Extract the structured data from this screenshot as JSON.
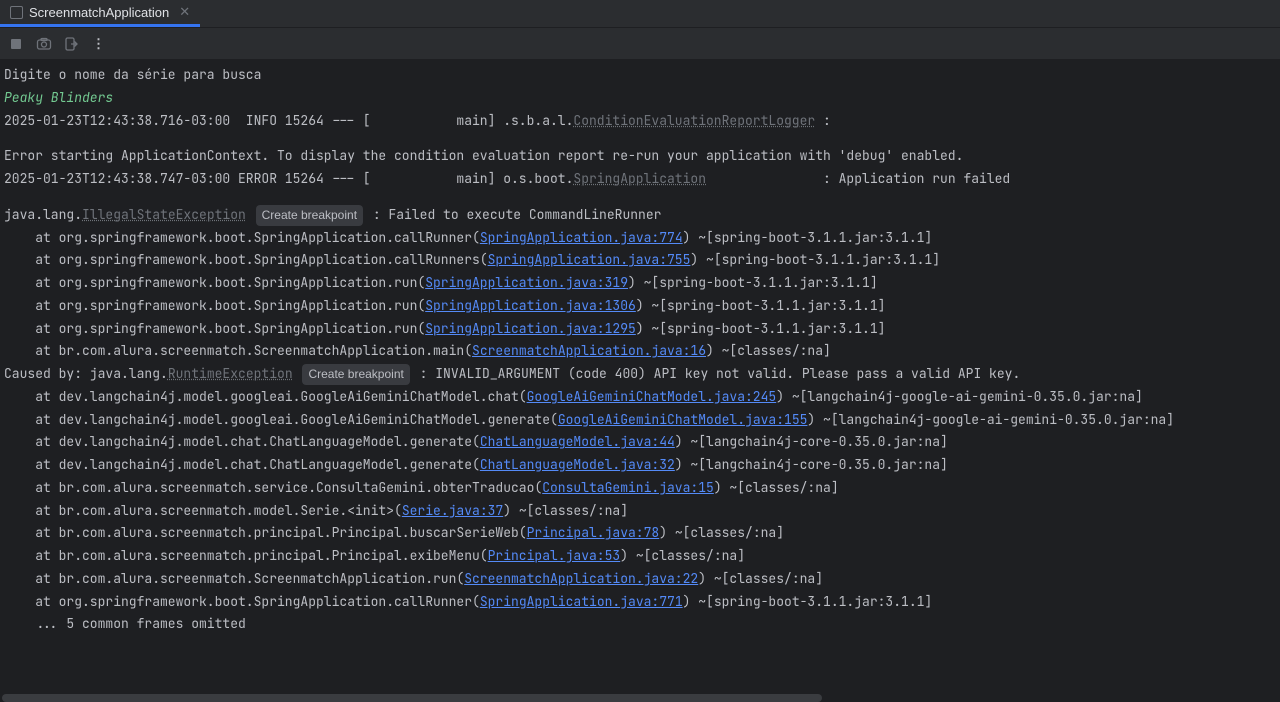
{
  "tab": {
    "title": "ScreenmatchApplication"
  },
  "console": {
    "prompt_line": "Digite o nome da série para busca",
    "user_input": "Peaky Blinders",
    "log_line1_prefix": "2025-01-23T12:43:38.716-03:00  INFO 15264 --- [           main] .s.b.a.l.",
    "log_line1_class": "ConditionEvaluationReportLogger",
    "log_line1_suffix": " :",
    "error_line": "Error starting ApplicationContext. To display the condition evaluation report re-run your application with 'debug' enabled.",
    "log_line2_prefix": "2025-01-23T12:43:38.747-03:00 ERROR 15264 --- [           main] o.s.boot.",
    "log_line2_class": "SpringApplication",
    "log_line2_suffix": "               : Application run failed",
    "exc_line_prefix": "java.lang.",
    "exc_class": "IllegalStateException",
    "breakpoint_label": "Create breakpoint",
    "exc_line_suffix": ": Failed to execute CommandLineRunner",
    "stack": [
      {
        "pre": "at org.springframework.boot.SpringApplication.callRunner(",
        "link": "SpringApplication.java:774",
        "post": ") ~[spring-boot-3.1.1.jar:3.1.1]"
      },
      {
        "pre": "at org.springframework.boot.SpringApplication.callRunners(",
        "link": "SpringApplication.java:755",
        "post": ") ~[spring-boot-3.1.1.jar:3.1.1]"
      },
      {
        "pre": "at org.springframework.boot.SpringApplication.run(",
        "link": "SpringApplication.java:319",
        "post": ") ~[spring-boot-3.1.1.jar:3.1.1]"
      },
      {
        "pre": "at org.springframework.boot.SpringApplication.run(",
        "link": "SpringApplication.java:1306",
        "post": ") ~[spring-boot-3.1.1.jar:3.1.1]"
      },
      {
        "pre": "at org.springframework.boot.SpringApplication.run(",
        "link": "SpringApplication.java:1295",
        "post": ") ~[spring-boot-3.1.1.jar:3.1.1]"
      },
      {
        "pre": "at br.com.alura.screenmatch.ScreenmatchApplication.main(",
        "link": "ScreenmatchApplication.java:16",
        "post": ") ~[classes/:na]"
      }
    ],
    "caused_prefix": "Caused by: java.lang.",
    "caused_class": "RuntimeException",
    "caused_suffix": ": INVALID_ARGUMENT (code 400) API key not valid. Please pass a valid API key.",
    "stack2": [
      {
        "pre": "at dev.langchain4j.model.googleai.GoogleAiGeminiChatModel.chat(",
        "link": "GoogleAiGeminiChatModel.java:245",
        "post": ") ~[langchain4j-google-ai-gemini-0.35.0.jar:na]"
      },
      {
        "pre": "at dev.langchain4j.model.googleai.GoogleAiGeminiChatModel.generate(",
        "link": "GoogleAiGeminiChatModel.java:155",
        "post": ") ~[langchain4j-google-ai-gemini-0.35.0.jar:na]"
      },
      {
        "pre": "at dev.langchain4j.model.chat.ChatLanguageModel.generate(",
        "link": "ChatLanguageModel.java:44",
        "post": ") ~[langchain4j-core-0.35.0.jar:na]"
      },
      {
        "pre": "at dev.langchain4j.model.chat.ChatLanguageModel.generate(",
        "link": "ChatLanguageModel.java:32",
        "post": ") ~[langchain4j-core-0.35.0.jar:na]"
      },
      {
        "pre": "at br.com.alura.screenmatch.service.ConsultaGemini.obterTraducao(",
        "link": "ConsultaGemini.java:15",
        "post": ") ~[classes/:na]"
      },
      {
        "pre": "at br.com.alura.screenmatch.model.Serie.<init>(",
        "link": "Serie.java:37",
        "post": ") ~[classes/:na]"
      },
      {
        "pre": "at br.com.alura.screenmatch.principal.Principal.buscarSerieWeb(",
        "link": "Principal.java:78",
        "post": ") ~[classes/:na]"
      },
      {
        "pre": "at br.com.alura.screenmatch.principal.Principal.exibeMenu(",
        "link": "Principal.java:53",
        "post": ") ~[classes/:na]"
      },
      {
        "pre": "at br.com.alura.screenmatch.ScreenmatchApplication.run(",
        "link": "ScreenmatchApplication.java:22",
        "post": ") ~[classes/:na]"
      },
      {
        "pre": "at org.springframework.boot.SpringApplication.callRunner(",
        "link": "SpringApplication.java:771",
        "post": ") ~[spring-boot-3.1.1.jar:3.1.1]"
      }
    ],
    "omitted_line": "... 5 common frames omitted"
  }
}
